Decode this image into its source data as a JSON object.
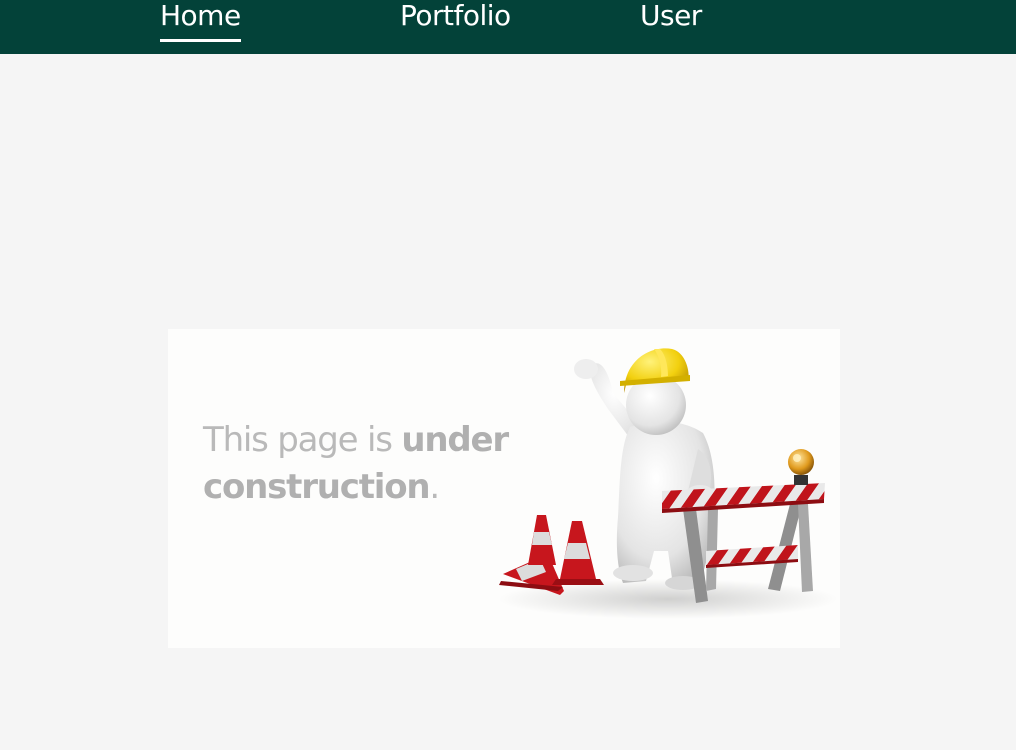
{
  "nav": {
    "items": [
      {
        "label": "Home",
        "active": true
      },
      {
        "label": "Portfolio",
        "active": false
      },
      {
        "label": "User",
        "active": false
      }
    ]
  },
  "banner": {
    "text_prefix": "This page is ",
    "text_bold_1": "under",
    "text_bold_2": "construction",
    "text_suffix": "."
  },
  "colors": {
    "nav_bg": "#034239",
    "page_bg": "#f5f5f5",
    "banner_bg": "#fdfdfc",
    "banner_text": "#b9b9b9",
    "helmet": "#f2d00f",
    "stripe_red": "#c0141b"
  },
  "icons": [
    "worker-waving-illustration",
    "traffic-cone-icon",
    "road-barrier-icon",
    "warning-light-icon"
  ]
}
